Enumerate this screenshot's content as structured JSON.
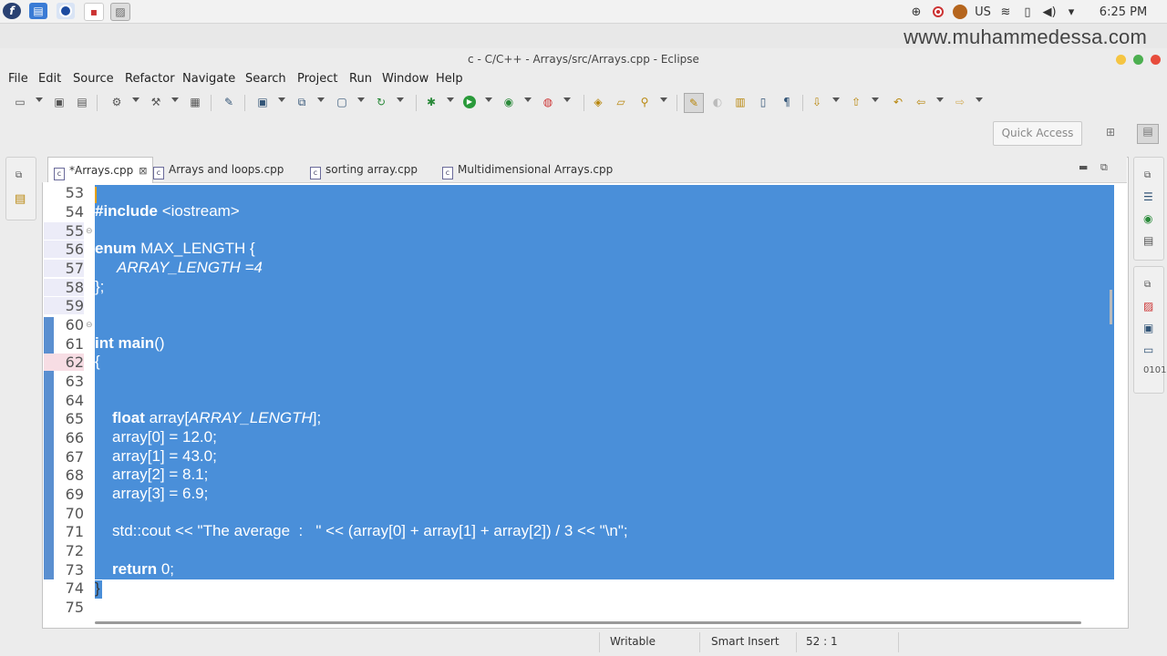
{
  "system_bar": {
    "launcher_icons": [
      "fedora-logo-icon",
      "file-manager-icon",
      "browser-icon",
      "media-icon",
      "image-viewer-icon"
    ],
    "tray": {
      "keyboard_layout": "US",
      "time": "6:25 PM"
    }
  },
  "watermark": "www.muhammedessa.com",
  "window": {
    "title": "c - C/C++ - Arrays/src/Arrays.cpp - Eclipse"
  },
  "menu": [
    "File",
    "Edit",
    "Source",
    "Refactor",
    "Navigate",
    "Search",
    "Project",
    "Run",
    "Window",
    "Help"
  ],
  "toolbar": {
    "quick_access_placeholder": "Quick Access"
  },
  "tabs": [
    {
      "label": "*Arrays.cpp",
      "active": true
    },
    {
      "label": "Arrays and loops.cpp",
      "active": false
    },
    {
      "label": "sorting array.cpp",
      "active": false
    },
    {
      "label": "Multidimensional Arrays.cpp",
      "active": false
    }
  ],
  "editor": {
    "line_numbers": [
      "53",
      "54",
      "55",
      "56",
      "57",
      "58",
      "59",
      "60",
      "61",
      "62",
      "63",
      "64",
      "65",
      "66",
      "67",
      "68",
      "69",
      "70",
      "71",
      "72",
      "73",
      "74",
      "75"
    ],
    "code": {
      "l54_kw": "#include",
      "l54_rest": " <iostream>",
      "l56_kw": "enum",
      "l56_rest": " MAX_LENGTH {",
      "l57": "ARRAY_LENGTH =4",
      "l58": "};",
      "l61_kw1": "int",
      "l61_kw2": "main",
      "l61_rest": "()",
      "l62": "{",
      "l65_kw": "float",
      "l65_a": " array[",
      "l65_b": "ARRAY_LENGTH",
      "l65_c": "];",
      "l66": "array[0] = 12.0;",
      "l67": "array[1] = 43.0;",
      "l68": "array[2] = 8.1;",
      "l69": "array[3] = 6.9;",
      "l71": "std::cout << \"The average  :   \" << (array[0] + array[1] + array[2]) / 3 << \"\\n\";",
      "l73_kw": "return",
      "l73_rest": " 0;",
      "l74": "}"
    }
  },
  "status": {
    "mode": "Writable",
    "insert": "Smart Insert",
    "position": "52 : 1"
  },
  "colors": {
    "selection": "#4a8fd9",
    "close_btn": "#e74c3c",
    "min_btn": "#f5c542",
    "max_btn": "#4caf50"
  }
}
